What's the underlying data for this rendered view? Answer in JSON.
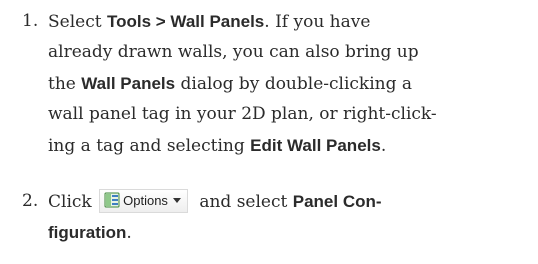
{
  "steps": [
    {
      "number": "1.",
      "lines": [
        [
          "Select ",
          "Tools > Wall Panels",
          ". If you have"
        ],
        [
          "already drawn walls, you can also bring up"
        ],
        [
          "the ",
          "Wall Panels",
          " dialog by double-clicking a"
        ],
        [
          "wall panel tag in your 2D plan, or right-click-"
        ],
        [
          "ing a tag and selecting ",
          "Edit Wall Panels",
          "."
        ]
      ]
    },
    {
      "number": "2.",
      "click_text": "Click",
      "button_label": "Options",
      "button_icon": "options-panel-icon",
      "after_button": " and select ",
      "bold_1": "Panel Con-",
      "line2_bold": "figuration",
      "line2_end": "."
    }
  ]
}
